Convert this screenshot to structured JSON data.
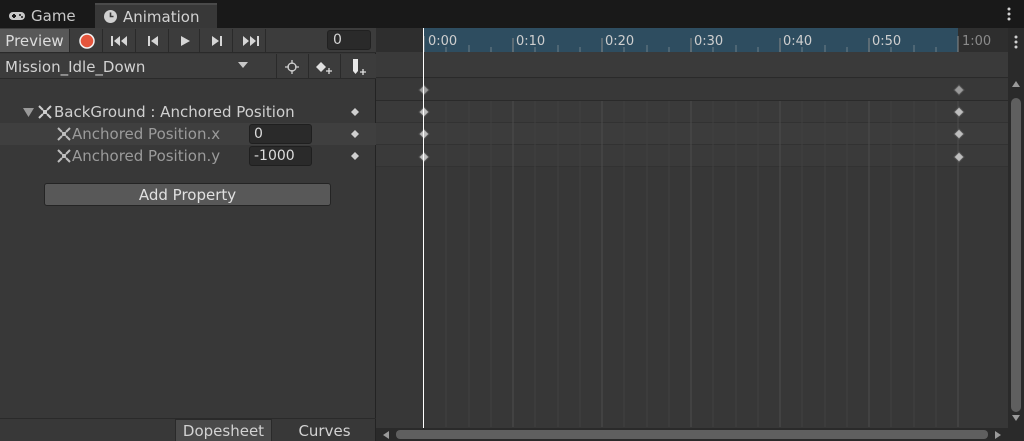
{
  "tabs": [
    {
      "label": "Game",
      "icon": "gamepad-icon"
    },
    {
      "label": "Animation",
      "icon": "clock-icon"
    }
  ],
  "toolbar": {
    "preview_label": "Preview",
    "frame_value": "0",
    "record_color": "#e5553c"
  },
  "clip": {
    "selected": "Mission_Idle_Down"
  },
  "properties": {
    "parent_label": "BackGround : Anchored Position",
    "children": [
      {
        "label": "Anchored Position.x",
        "value": "0"
      },
      {
        "label": "Anchored Position.y",
        "value": "-1000"
      }
    ]
  },
  "add_property_label": "Add Property",
  "bottom_tabs": {
    "dopesheet": "Dopesheet",
    "curves": "Curves"
  },
  "timeline": {
    "ruler_labels": [
      "0:00",
      "0:10",
      "0:20",
      "0:30",
      "0:40",
      "0:50",
      "1:00"
    ],
    "accent_color": "#2e4d60"
  }
}
